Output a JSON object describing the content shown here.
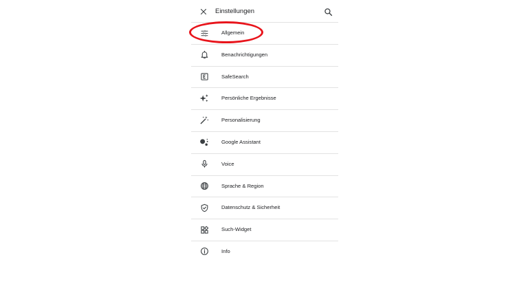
{
  "header": {
    "title": "Einstellungen",
    "close_icon": "close-icon",
    "search_icon": "search-icon"
  },
  "menu": {
    "items": [
      {
        "label": "Allgemein",
        "icon": "tune-icon"
      },
      {
        "label": "Benachrichtigungen",
        "icon": "bell-icon"
      },
      {
        "label": "SafeSearch",
        "icon": "explicit-icon"
      },
      {
        "label": "Persönliche Ergebnisse",
        "icon": "sparkle-icon"
      },
      {
        "label": "Personalisierung",
        "icon": "magic-wand-icon"
      },
      {
        "label": "Google Assistant",
        "icon": "assistant-icon"
      },
      {
        "label": "Voice",
        "icon": "mic-icon"
      },
      {
        "label": "Sprache & Region",
        "icon": "globe-icon"
      },
      {
        "label": "Datenschutz & Sicherheit",
        "icon": "shield-icon"
      },
      {
        "label": "Such-Widget",
        "icon": "widgets-icon"
      },
      {
        "label": "Info",
        "icon": "info-icon"
      }
    ]
  },
  "annotation": {
    "highlight_color": "#e8141b",
    "highlighted_item": "Allgemein"
  },
  "colors": {
    "text": "#202124",
    "icon": "#3c4043",
    "divider": "#e2e2e2",
    "background": "#ffffff"
  }
}
